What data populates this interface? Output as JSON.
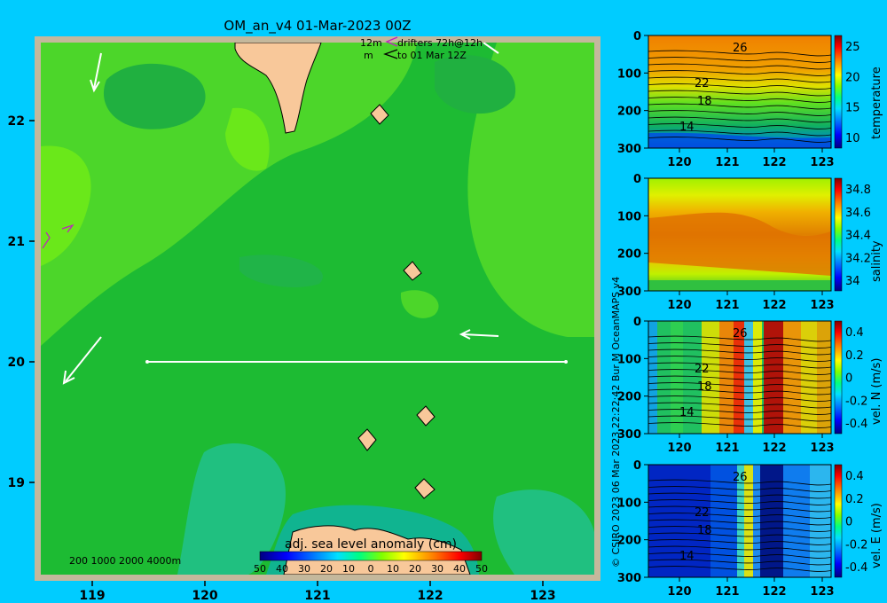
{
  "map": {
    "title": "OM_an_v4  01-Mar-2023 00Z",
    "lon_ticks": [
      "119",
      "120",
      "121",
      "122",
      "123"
    ],
    "lat_ticks": [
      "22",
      "21",
      "20",
      "19"
    ],
    "legend_line1": "12m",
    "legend_text1": "drifters 72h@12h",
    "legend_line2": "m",
    "legend_text2": "to 01 Mar 12Z",
    "depth_legend": "200  1000  2000  4000m",
    "colorbar_title": "adj. sea level anomaly (cm)",
    "colorbar_ticks": [
      "50",
      "40",
      "30",
      "20",
      "10",
      "0",
      "10",
      "20",
      "30",
      "40",
      "50"
    ],
    "credit": "© CSIRO 2023  06 Mar 2023 22:22:42 Bur M OceanMAPS v4"
  },
  "panels": [
    {
      "id": "temperature",
      "label": "temperature",
      "depth_ticks": [
        "0",
        "100",
        "200",
        "300"
      ],
      "lon_ticks": [
        "120",
        "121",
        "122",
        "123"
      ],
      "cb_ticks": [
        "25",
        "20",
        "15",
        "10"
      ],
      "contour_labels": [
        "26",
        "22",
        "18",
        "14"
      ]
    },
    {
      "id": "salinity",
      "label": "salinity",
      "depth_ticks": [
        "0",
        "100",
        "200",
        "300"
      ],
      "lon_ticks": [
        "120",
        "121",
        "122",
        "123"
      ],
      "cb_ticks": [
        "34.8",
        "34.6",
        "34.4",
        "34.2",
        "34"
      ],
      "contour_labels": []
    },
    {
      "id": "vel-n",
      "label": "vel. N (m/s)",
      "depth_ticks": [
        "0",
        "100",
        "200",
        "300"
      ],
      "lon_ticks": [
        "120",
        "121",
        "122",
        "123"
      ],
      "cb_ticks": [
        "0.4",
        "0.2",
        "0",
        "-0.2",
        "-0.4"
      ],
      "contour_labels": [
        "26",
        "22",
        "18",
        "14"
      ]
    },
    {
      "id": "vel-e",
      "label": "vel. E (m/s)",
      "depth_ticks": [
        "0",
        "100",
        "200",
        "300"
      ],
      "lon_ticks": [
        "120",
        "121",
        "122",
        "123"
      ],
      "cb_ticks": [
        "0.4",
        "0.2",
        "0",
        "-0.2",
        "-0.4"
      ],
      "contour_labels": [
        "26",
        "22",
        "18",
        "14"
      ]
    }
  ],
  "colors": {
    "background": "#00ccff",
    "map_base": "#1dbb33",
    "land": "#f8c89a",
    "frame": "#c4b89c"
  }
}
